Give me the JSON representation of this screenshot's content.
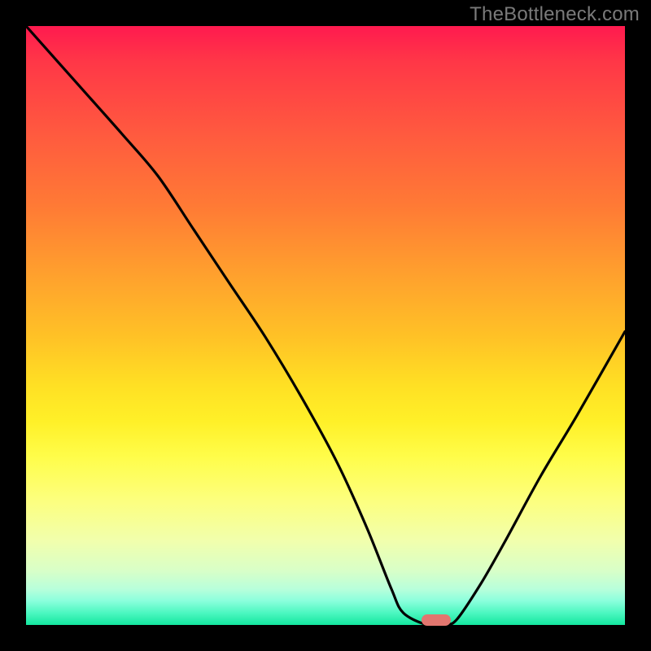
{
  "watermark": "TheBottleneck.com",
  "colors": {
    "frame": "#000000",
    "curve": "#000000",
    "marker": "#e2766f",
    "gradient_top": "#ff1a4f",
    "gradient_bottom": "#13e79f"
  },
  "chart_data": {
    "type": "line",
    "title": "",
    "xlabel": "",
    "ylabel": "",
    "xlim": [
      0,
      100
    ],
    "ylim": [
      0,
      100
    ],
    "x": [
      0,
      8,
      16,
      22,
      28,
      34,
      40,
      46,
      52,
      57,
      61,
      63,
      67,
      70,
      72,
      76,
      80,
      86,
      92,
      100
    ],
    "values": [
      100,
      91,
      82,
      75,
      66,
      57,
      48,
      38,
      27,
      16,
      6,
      2,
      0,
      0,
      1,
      7,
      14,
      25,
      35,
      49
    ],
    "marker": {
      "x": 68.5,
      "y": 0.8
    },
    "annotations": []
  }
}
